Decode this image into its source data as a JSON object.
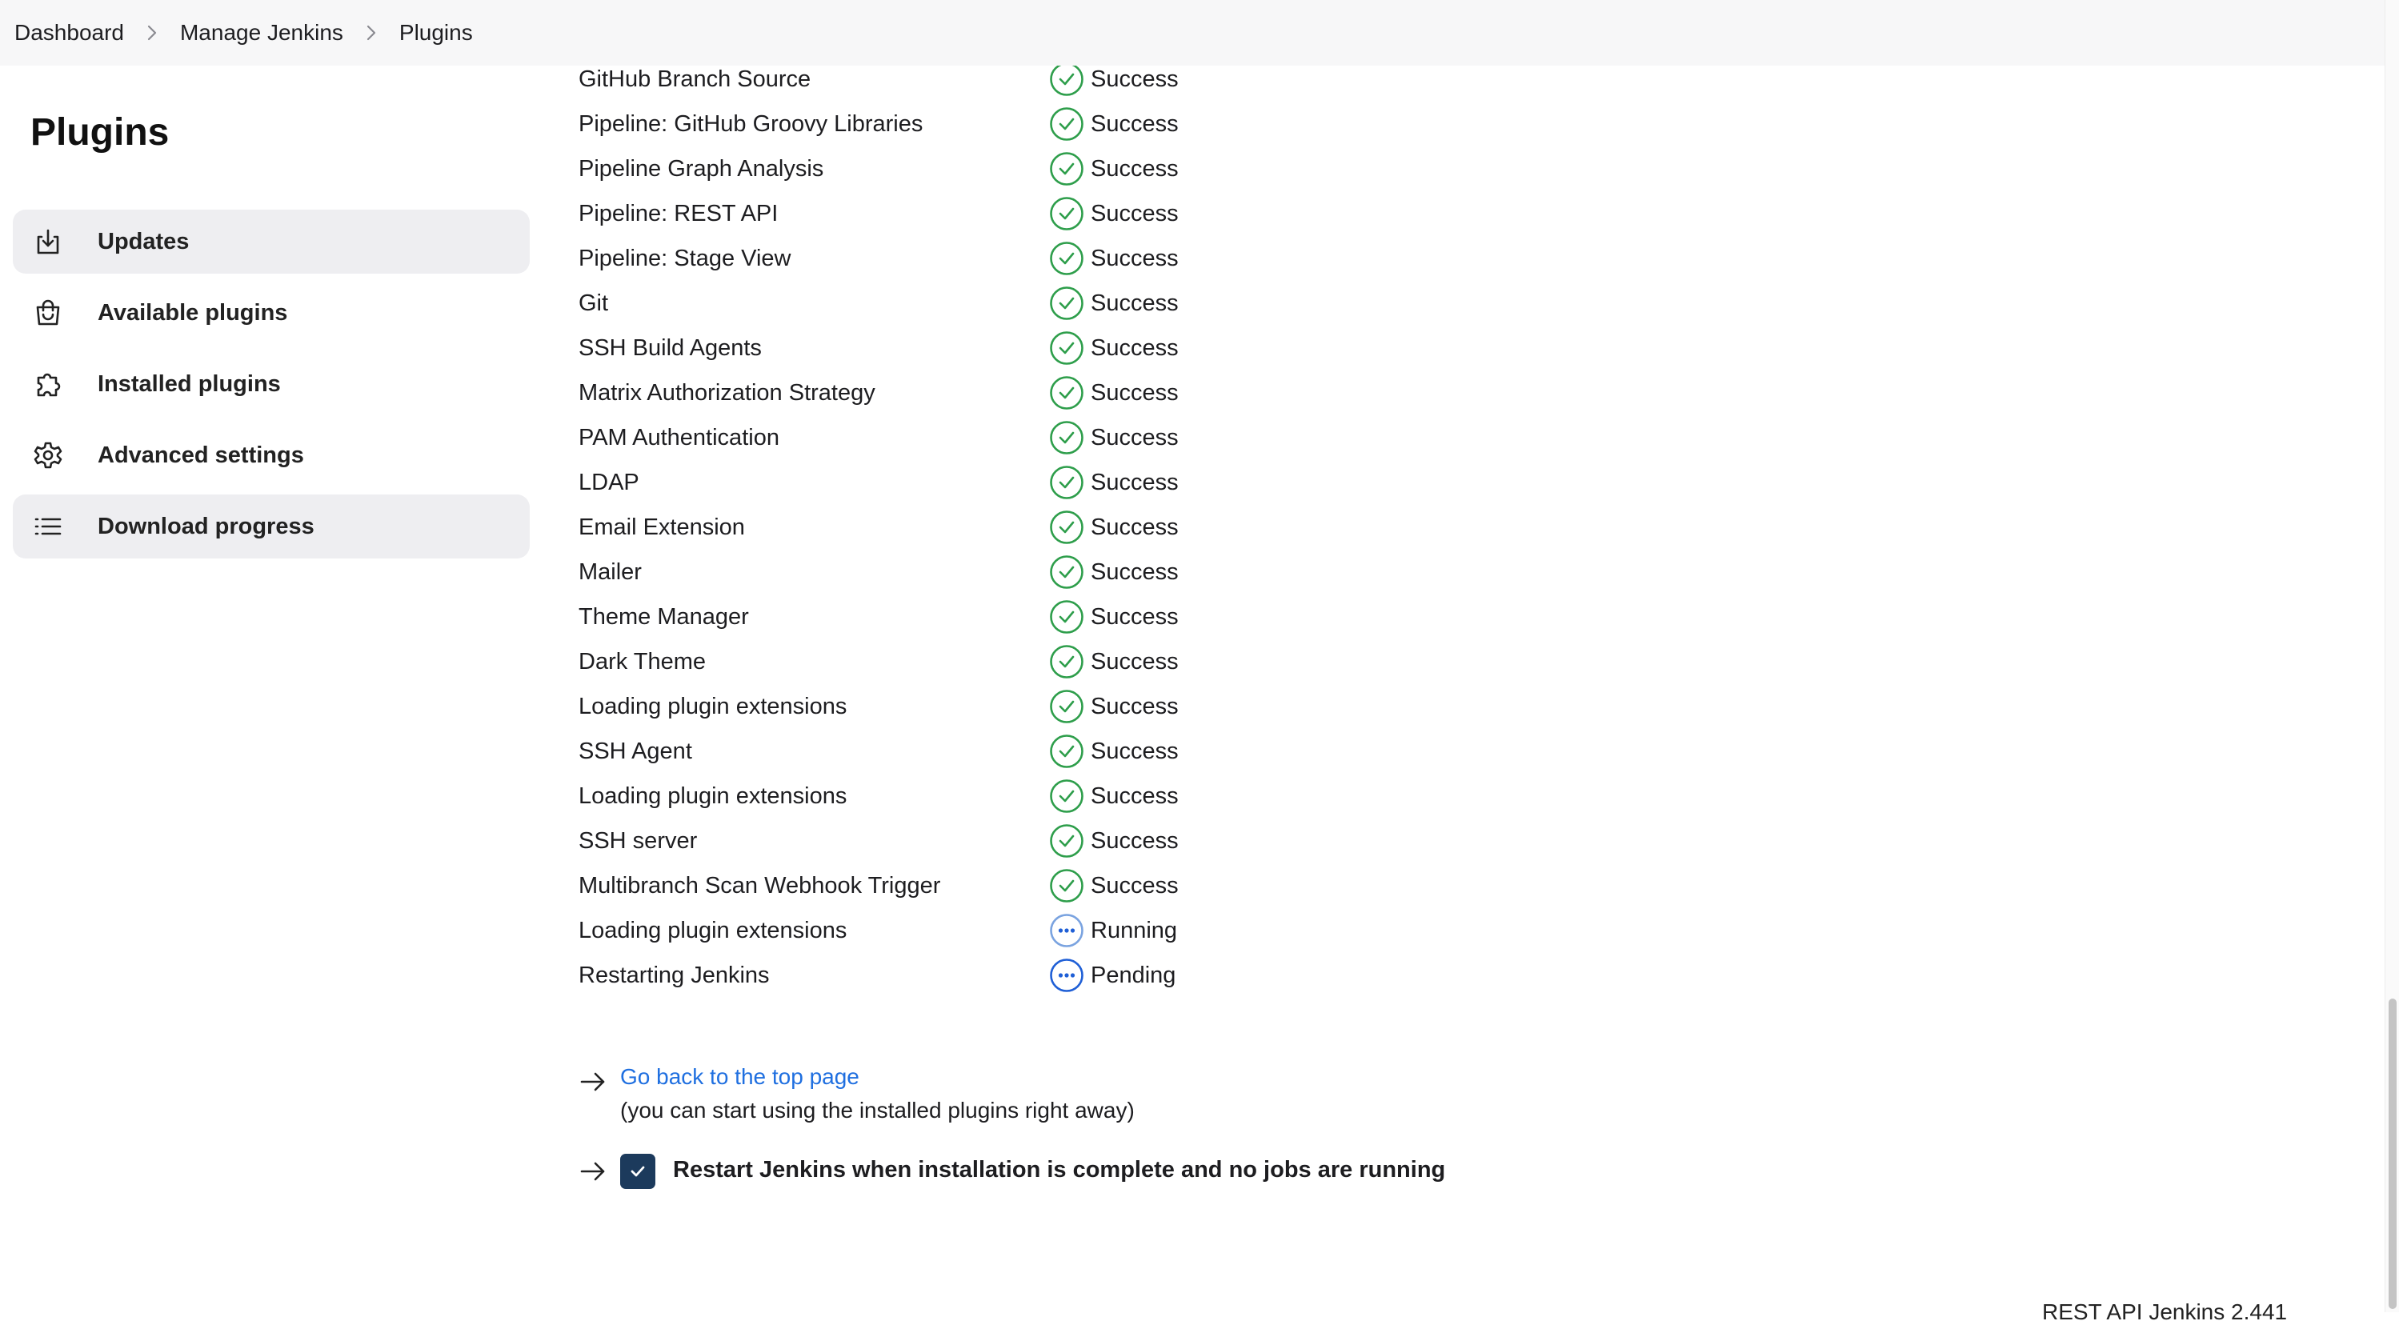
{
  "breadcrumb": {
    "items": [
      "Dashboard",
      "Manage Jenkins",
      "Plugins"
    ]
  },
  "page": {
    "title": "Plugins"
  },
  "sidebar": {
    "items": [
      {
        "label": "Updates",
        "icon": "download-icon",
        "active": true
      },
      {
        "label": "Available plugins",
        "icon": "shopping-bag-icon",
        "active": false
      },
      {
        "label": "Installed plugins",
        "icon": "puzzle-icon",
        "active": false
      },
      {
        "label": "Advanced settings",
        "icon": "gear-icon",
        "active": false
      },
      {
        "label": "Download progress",
        "icon": "list-icon",
        "active": true
      }
    ]
  },
  "progress": {
    "rows": [
      {
        "name": "GitHub Branch Source",
        "status": "Success"
      },
      {
        "name": "Pipeline: GitHub Groovy Libraries",
        "status": "Success"
      },
      {
        "name": "Pipeline Graph Analysis",
        "status": "Success"
      },
      {
        "name": "Pipeline: REST API",
        "status": "Success"
      },
      {
        "name": "Pipeline: Stage View",
        "status": "Success"
      },
      {
        "name": "Git",
        "status": "Success"
      },
      {
        "name": "SSH Build Agents",
        "status": "Success"
      },
      {
        "name": "Matrix Authorization Strategy",
        "status": "Success"
      },
      {
        "name": "PAM Authentication",
        "status": "Success"
      },
      {
        "name": "LDAP",
        "status": "Success"
      },
      {
        "name": "Email Extension",
        "status": "Success"
      },
      {
        "name": "Mailer",
        "status": "Success"
      },
      {
        "name": "Theme Manager",
        "status": "Success"
      },
      {
        "name": "Dark Theme",
        "status": "Success"
      },
      {
        "name": "Loading plugin extensions",
        "status": "Success"
      },
      {
        "name": "SSH Agent",
        "status": "Success"
      },
      {
        "name": "Loading plugin extensions",
        "status": "Success"
      },
      {
        "name": "SSH server",
        "status": "Success"
      },
      {
        "name": "Multibranch Scan Webhook Trigger",
        "status": "Success"
      },
      {
        "name": "Loading plugin extensions",
        "status": "Running"
      },
      {
        "name": "Restarting Jenkins",
        "status": "Pending"
      }
    ]
  },
  "actions": {
    "top_link": "Go back to the top page",
    "top_note": "(you can start using the installed plugins right away)",
    "restart_label": "Restart Jenkins when installation is complete and no jobs are running",
    "restart_checked": true
  },
  "footer": {
    "text": "REST API    Jenkins 2.441"
  },
  "colors": {
    "success": "#2e9e4b",
    "running": "#7aa3e0",
    "pending": "#1f5fd6",
    "link": "#1f6fe0",
    "checkbox": "#1c3a5c",
    "active_nav_bg": "#eeeef1",
    "breadcrumb_bg": "#f7f7f8"
  }
}
